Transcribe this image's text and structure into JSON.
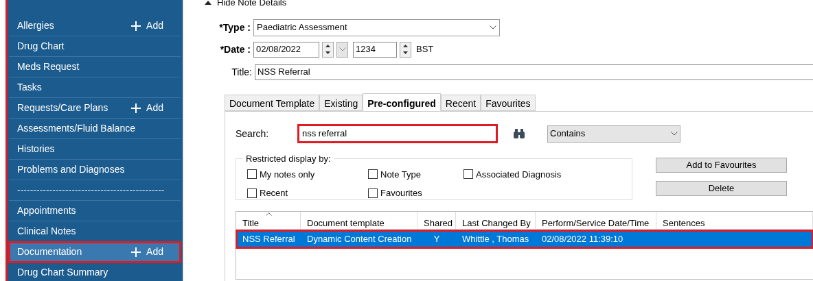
{
  "sidebar": {
    "items": [
      {
        "label": "Allergies",
        "add": "Add",
        "selected": false,
        "annotated": false,
        "kind": "link"
      },
      {
        "label": "Drug Chart",
        "selected": false,
        "annotated": false,
        "kind": "link"
      },
      {
        "label": "Meds Request",
        "selected": false,
        "annotated": false,
        "kind": "link"
      },
      {
        "label": "Tasks",
        "selected": false,
        "annotated": false,
        "kind": "link"
      },
      {
        "label": "Requests/Care Plans",
        "add": "Add",
        "selected": false,
        "annotated": false,
        "kind": "link"
      },
      {
        "label": "Assessments/Fluid Balance",
        "selected": false,
        "annotated": false,
        "kind": "link"
      },
      {
        "label": "Histories",
        "selected": false,
        "annotated": false,
        "kind": "link"
      },
      {
        "label": "Problems and Diagnoses",
        "selected": false,
        "annotated": false,
        "kind": "link"
      },
      {
        "label": "----------------------------------------------",
        "selected": false,
        "annotated": false,
        "kind": "separator"
      },
      {
        "label": "Appointments",
        "selected": false,
        "annotated": false,
        "kind": "link"
      },
      {
        "label": "Clinical Notes",
        "selected": false,
        "annotated": false,
        "kind": "link"
      },
      {
        "label": "Documentation",
        "add": "Add",
        "selected": true,
        "annotated": true,
        "kind": "link"
      },
      {
        "label": "Drug Chart Summary",
        "selected": false,
        "annotated": false,
        "kind": "link"
      }
    ]
  },
  "note": {
    "toggle": "Hide Note Details",
    "type_label": "*Type :",
    "type_value": "Paediatric Assessment",
    "date_label": "*Date :",
    "date_value": "02/08/2022",
    "time_value": "1234",
    "timezone": "BST",
    "title_label": "Title:",
    "title_value": "NSS Referral"
  },
  "tabs": [
    {
      "label": "Document Template",
      "selected": false
    },
    {
      "label": "Existing",
      "selected": false
    },
    {
      "label": "Pre-configured",
      "selected": true
    },
    {
      "label": "Recent",
      "selected": false
    },
    {
      "label": "Favourites",
      "selected": false
    }
  ],
  "search": {
    "label": "Search:",
    "value": "nss referral",
    "annotated": true,
    "mode": "Contains"
  },
  "restrict": {
    "legend": "Restricted display by:",
    "options": [
      {
        "label": "My notes only",
        "checked": false
      },
      {
        "label": "Note Type",
        "checked": false
      },
      {
        "label": "Associated Diagnosis",
        "checked": false
      },
      {
        "label": "Recent",
        "checked": false
      },
      {
        "label": "Favourites",
        "checked": false
      }
    ]
  },
  "buttons": [
    "Add to Favourites",
    "Delete"
  ],
  "table": {
    "columns": [
      "Title",
      "Document template",
      "Shared",
      "Last Changed By",
      "Perform/Service Date/Time",
      "Sentences"
    ],
    "rows": [
      {
        "cells": [
          "NSS Referral",
          "Dynamic Content Creation",
          "Y",
          "Whittle , Thomas",
          "02/08/2022 11:39:10",
          ""
        ],
        "selected": true,
        "annotated": true
      }
    ]
  }
}
